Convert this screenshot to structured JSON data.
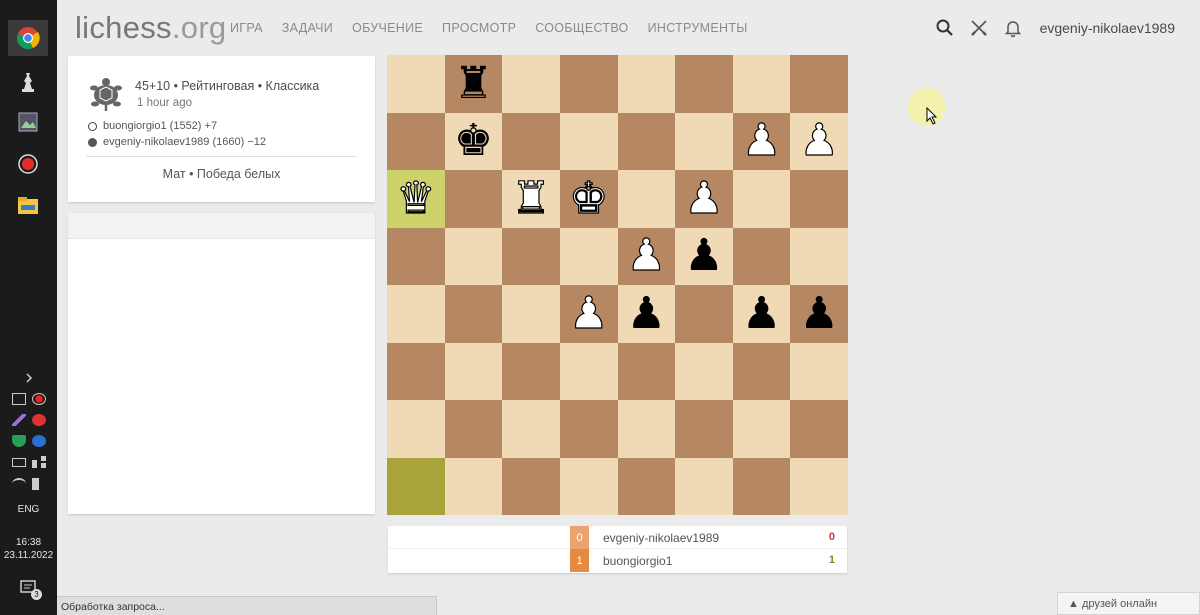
{
  "taskbar": {
    "keyboard_layout": "ENG",
    "clock_time": "16:38",
    "clock_date": "23.11.2022",
    "notification_count": "3"
  },
  "header": {
    "logo_main": "lichess",
    "logo_tld": ".org",
    "nav": [
      "ИГРА",
      "ЗАДАЧИ",
      "ОБУЧЕНИЕ",
      "ПРОСМОТР",
      "СООБЩЕСТВО",
      "ИНСТРУМЕНТЫ"
    ],
    "username": "evgeniy-nikolaev1989"
  },
  "game_info": {
    "setup": "45+10 • Рейтинговая • Классика",
    "time_ago": "1 hour ago",
    "white_player": "buongiorgio1 (1552) +7",
    "black_player": "evgeniy-nikolaev1989 (1660) −12",
    "result": "Мат • Победа белых"
  },
  "board": {
    "ranks": [
      [
        null,
        "bR",
        null,
        null,
        null,
        null,
        null,
        null
      ],
      [
        null,
        "bK",
        null,
        null,
        null,
        null,
        "wP",
        "wP"
      ],
      [
        "wQ",
        null,
        "wR",
        "wK",
        null,
        "wP",
        null,
        null
      ],
      [
        null,
        null,
        null,
        null,
        "wP",
        "bP",
        null,
        null
      ],
      [
        null,
        null,
        null,
        "wP",
        "bP",
        null,
        "bP",
        "bP"
      ],
      [
        null,
        null,
        null,
        null,
        null,
        null,
        null,
        null
      ],
      [
        null,
        null,
        null,
        null,
        null,
        null,
        null,
        null
      ],
      [
        null,
        null,
        null,
        null,
        null,
        null,
        null,
        null
      ]
    ],
    "highlighted": [
      "6-0",
      "1-8"
    ]
  },
  "score_table": {
    "rows": [
      {
        "index": "0",
        "name": "evgeniy-nikolaev1989",
        "points": "0"
      },
      {
        "index": "1",
        "name": "buongiorgio1",
        "points": "1"
      }
    ]
  },
  "status_bar": {
    "text": "Обработка запроса..."
  },
  "friends": {
    "label": "▲ друзей онлайн"
  },
  "colors": {
    "light_square": "#f0d9b5",
    "dark_square": "#b58863",
    "highlight": "#cdd26a",
    "accent_orange": "#e58a43"
  }
}
